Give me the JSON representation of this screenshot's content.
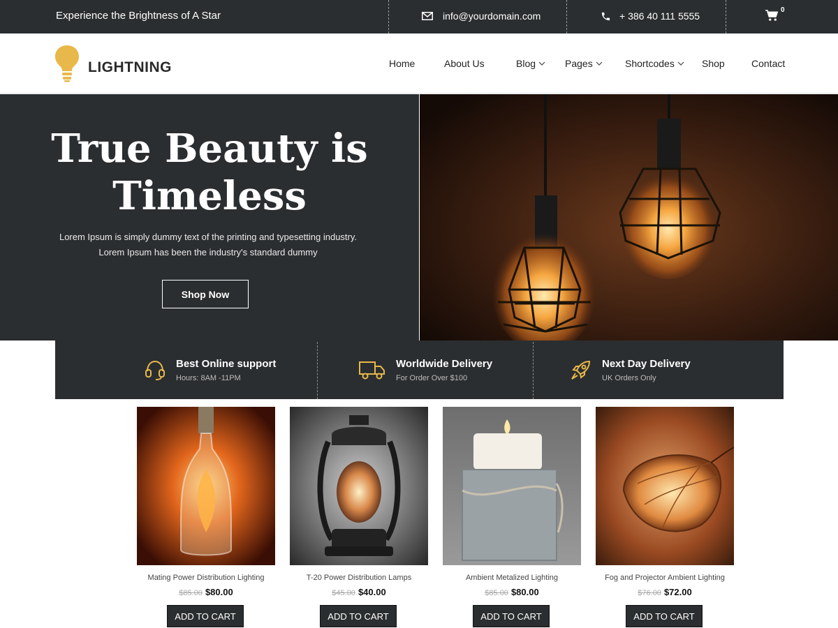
{
  "topbar": {
    "tagline": "Experience the Brightness of A Star",
    "email": "info@yourdomain.com",
    "phone": "+ 386 40 111 5555",
    "cart_count": "0"
  },
  "header": {
    "logo_text": "LIGHTNING",
    "nav": [
      {
        "label": "Home"
      },
      {
        "label": "About Us"
      },
      {
        "label": "Blog",
        "dropdown": true
      },
      {
        "label": "Pages",
        "dropdown": true
      },
      {
        "label": "Shortcodes",
        "dropdown": true
      },
      {
        "label": "Shop"
      },
      {
        "label": "Contact"
      }
    ]
  },
  "hero": {
    "title_line1": "True Beauty is",
    "title_line2": "Timeless",
    "desc_line1": "Lorem Ipsum is simply dummy text of the printing and typesetting industry.",
    "desc_line2": "Lorem Ipsum has been the industry's standard dummy",
    "button": "Shop Now"
  },
  "features": [
    {
      "title": "Best Online support",
      "subtitle": "Hours: 8AM -11PM",
      "icon": "headset-icon"
    },
    {
      "title": "Worldwide Delivery",
      "subtitle": "For Order Over $100",
      "icon": "truck-icon"
    },
    {
      "title": "Next Day Delivery",
      "subtitle": "UK Orders Only",
      "icon": "rocket-icon"
    }
  ],
  "products": [
    {
      "name": "Mating Power Distribution Lighting",
      "old_price": "$85.00",
      "price": "$80.00",
      "button": "ADD TO CART"
    },
    {
      "name": "T-20 Power Distribution Lamps",
      "old_price": "$45.00",
      "price": "$40.00",
      "button": "ADD TO CART"
    },
    {
      "name": "Ambient Metalized Lighting",
      "old_price": "$85.00",
      "price": "$80.00",
      "button": "ADD TO CART"
    },
    {
      "name": "Fog and Projector Ambient Lighting",
      "old_price": "$76.00",
      "price": "$72.00",
      "button": "ADD TO CART"
    }
  ],
  "colors": {
    "dark": "#2b2e30",
    "accent": "#e8b84a",
    "white": "#ffffff"
  }
}
